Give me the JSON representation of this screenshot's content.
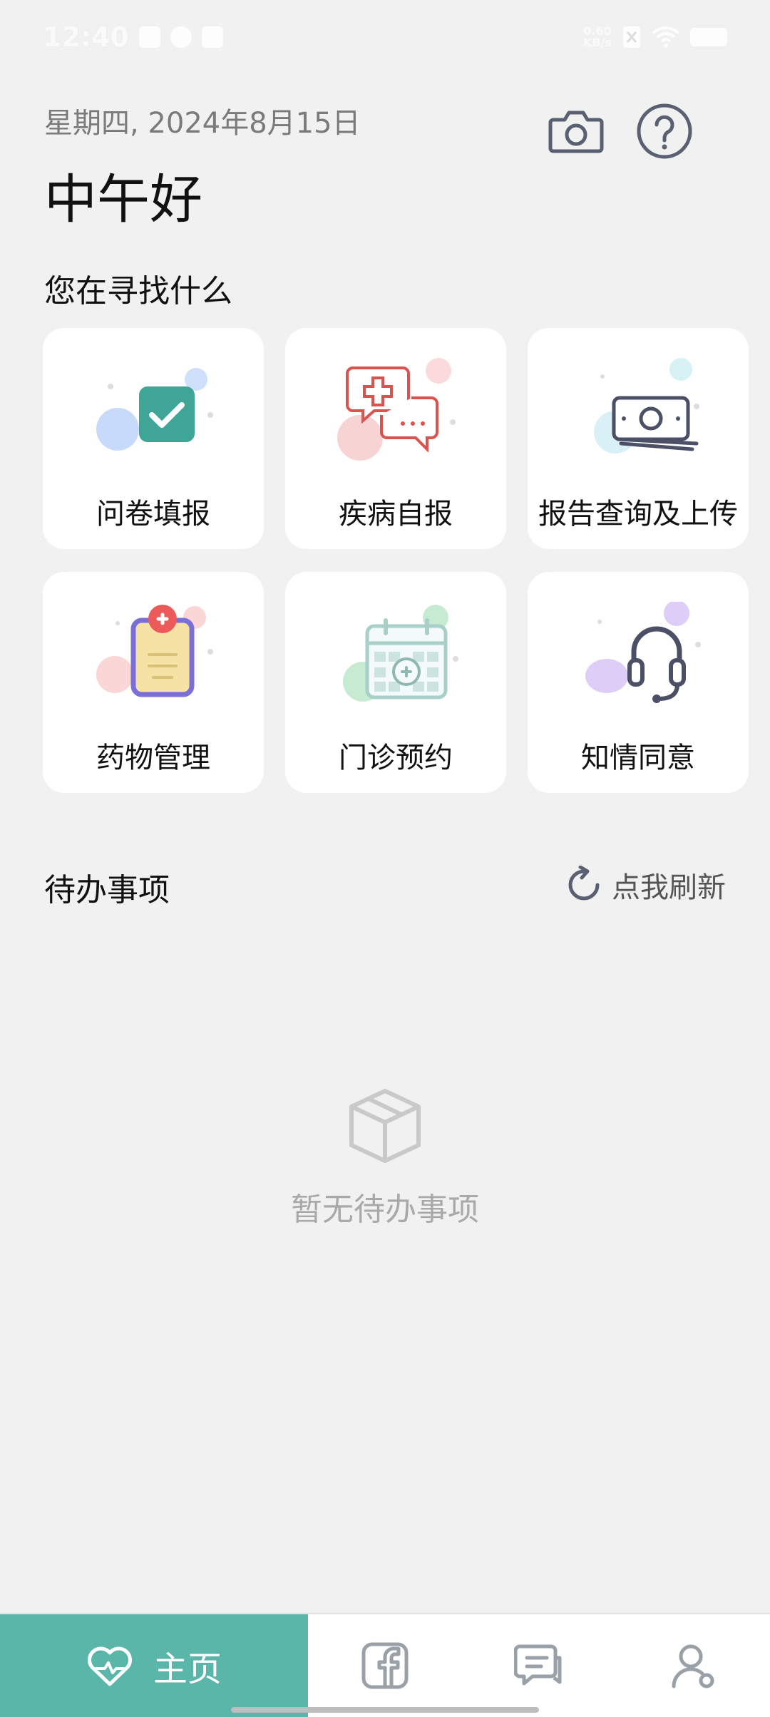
{
  "status": {
    "time": "12:40",
    "net_speed_value": "0.60",
    "net_speed_unit": "KB/s"
  },
  "header": {
    "date": "星期四, 2024年8月15日",
    "greeting": "中午好"
  },
  "icons": {
    "camera": "camera-icon",
    "help": "help-icon"
  },
  "find": {
    "title": "您在寻找什么",
    "items": [
      {
        "label": "问卷填报",
        "icon": "questionnaire-check-icon",
        "color": "#3fa596"
      },
      {
        "label": "疾病自报",
        "icon": "medical-chat-icon",
        "color": "#d9534f"
      },
      {
        "label": "报告查询及上传",
        "icon": "money-stack-icon",
        "color": "#4b5066"
      },
      {
        "label": "药物管理",
        "icon": "medicine-clipboard-icon",
        "color": "#7a6fd6"
      },
      {
        "label": "门诊预约",
        "icon": "calendar-cross-icon",
        "color": "#8fb8b3"
      },
      {
        "label": "知情同意",
        "icon": "headset-icon",
        "color": "#4b5066"
      }
    ]
  },
  "todo": {
    "title": "待办事项",
    "refresh_label": "点我刷新",
    "empty_text": "暂无待办事项"
  },
  "tabbar": {
    "home_label": "主页",
    "accent": "#5bb6aa",
    "tabs": [
      "home-heart-icon",
      "facebook-icon",
      "chat-icon",
      "profile-icon"
    ]
  }
}
